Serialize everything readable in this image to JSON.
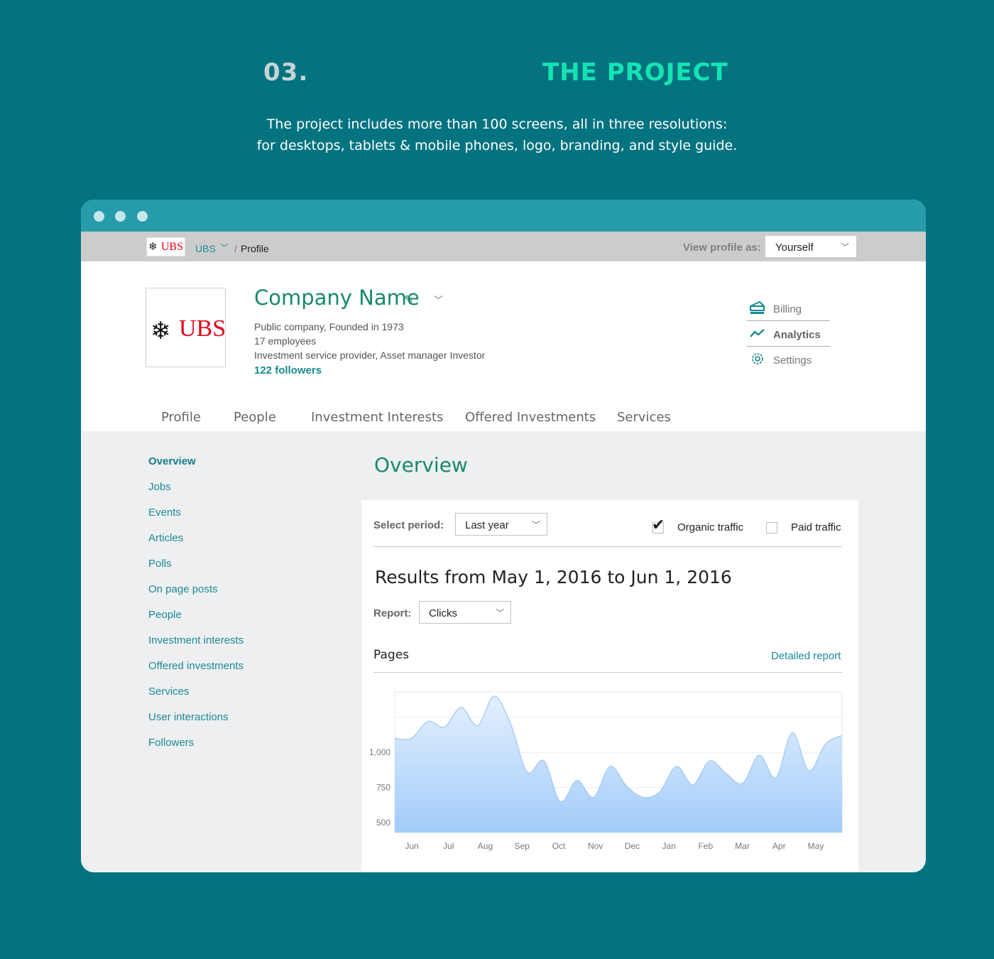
{
  "hero": {
    "number": "03.",
    "title": "THE PROJECT",
    "description_line1": "The project includes more than 100 screens, all in three resolutions:",
    "description_line2": "for desktops, tablets & mobile phones, logo, branding, and style guide."
  },
  "topbar": {
    "logo_text": "UBS",
    "breadcrumb_company": "UBS",
    "breadcrumb_sep": "/",
    "breadcrumb_page": "Profile",
    "view_as_label": "View profile as:",
    "view_as_value": "Yourself"
  },
  "company": {
    "logo_text": "UBS",
    "name": "Company Name",
    "type": "Public company, Founded in 1973",
    "employees": "17 employees",
    "description": "Investment service provider, Asset manager Investor",
    "followers": "122 followers"
  },
  "right_menu": [
    {
      "label": "Billing",
      "icon": "billing-icon"
    },
    {
      "label": "Analytics",
      "icon": "analytics-icon"
    },
    {
      "label": "Settings",
      "icon": "gear-icon"
    }
  ],
  "tabs": [
    "Profile",
    "People",
    "Investment Interests",
    "Offered Investments",
    "Services"
  ],
  "sidenav": [
    "Overview",
    "Jobs",
    "Events",
    "Articles",
    "Polls",
    "On page posts",
    "People",
    "Investment interests",
    "Offered investments",
    "Services",
    "User interactions",
    "Followers"
  ],
  "overview": {
    "title": "Overview",
    "select_period_label": "Select period:",
    "period_value": "Last year",
    "organic_label": "Organic traffic",
    "organic_checked": true,
    "paid_label": "Paid traffic",
    "paid_checked": false,
    "results_title": "Results from May 1, 2016 to Jun 1, 2016",
    "report_label": "Report:",
    "report_value": "Clicks",
    "pages_label": "Pages",
    "detailed_link": "Detailed report"
  },
  "colors": {
    "background": "#02737f",
    "accent_green": "#178a6a",
    "link_teal": "#1c8a97",
    "hero_title": "#15e3b3",
    "titlebar": "#269cab",
    "chart_fill": "#a9d0fb"
  },
  "chart_data": {
    "type": "area",
    "x": [
      "Jun",
      "Jul",
      "Aug",
      "Sep",
      "Oct",
      "Nov",
      "Dec",
      "Jan",
      "Feb",
      "Mar",
      "Apr",
      "May"
    ],
    "series": [
      {
        "values": [
          1100,
          1100,
          1220,
          1180,
          1320,
          1190,
          1400,
          1200,
          860,
          940,
          650,
          800,
          680,
          900,
          760,
          680,
          720,
          900,
          770,
          940,
          850,
          780,
          980,
          820,
          1140,
          870,
          1060,
          1120
        ]
      }
    ],
    "y_ticks": [
      500,
      750,
      1000
    ],
    "ylim": [
      430,
      1430
    ],
    "grid": true
  }
}
